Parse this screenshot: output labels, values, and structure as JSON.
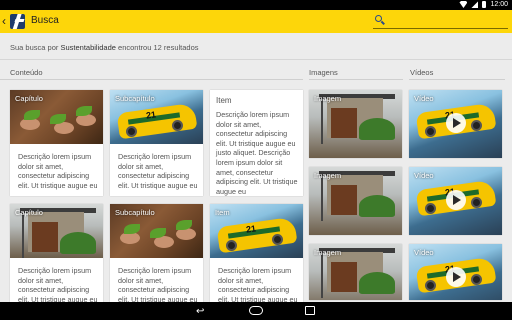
{
  "status": {
    "time": "12:00"
  },
  "header": {
    "title": "Busca",
    "search_value": ""
  },
  "summary": {
    "prefix": "Sua busca por",
    "term": "Sustentabilidade",
    "suffix": "encontrou 12 resultados"
  },
  "sections": {
    "content": "Conteúdo",
    "images": "Imagens",
    "videos": "Vídeos"
  },
  "content_cards": [
    {
      "label": "Capítulo",
      "desc": "Descrição lorem ipsum dolor sit amet, consectetur adipiscing elit. Ut tristique augue eu"
    },
    {
      "label": "Subcapítulo",
      "desc": "Descrição lorem ipsum dolor sit amet, consectetur adipiscing elit. Ut tristique augue eu"
    },
    {
      "label": "Item",
      "desc": "Descrição lorem ipsum dolor sit amet, consectetur adipiscing elit. Ut tristique augue eu justo aliquet. Descrição lorem ipsum dolor sit amet, consectetur adipiscing elit. Ut tristique augue eu"
    },
    {
      "label": "Capítulo",
      "desc": "Descrição lorem ipsum dolor sit amet, consectetur adipiscing elit. Ut tristique augue eu"
    },
    {
      "label": "Subcapítulo",
      "desc": "Descrição lorem ipsum dolor sit amet, consectetur adipiscing elit. Ut tristique augue eu"
    },
    {
      "label": "Item",
      "desc": "Descrição lorem ipsum dolor sit amet, consectetur adipiscing elit. Ut tristique augue eu"
    }
  ],
  "image_cards": [
    {
      "label": "Imagem"
    },
    {
      "label": "Imagem"
    },
    {
      "label": "Imagem"
    }
  ],
  "video_cards": [
    {
      "label": "Vídeo"
    },
    {
      "label": "Vídeo"
    },
    {
      "label": "Vídeo"
    }
  ],
  "colors": {
    "appbar": "#fdd60a",
    "logo": "#1f3b6b"
  },
  "icons": [
    "back-icon",
    "logo-icon",
    "search-icon",
    "play-icon",
    "nav-back-icon",
    "nav-home-icon",
    "nav-recent-icon"
  ]
}
